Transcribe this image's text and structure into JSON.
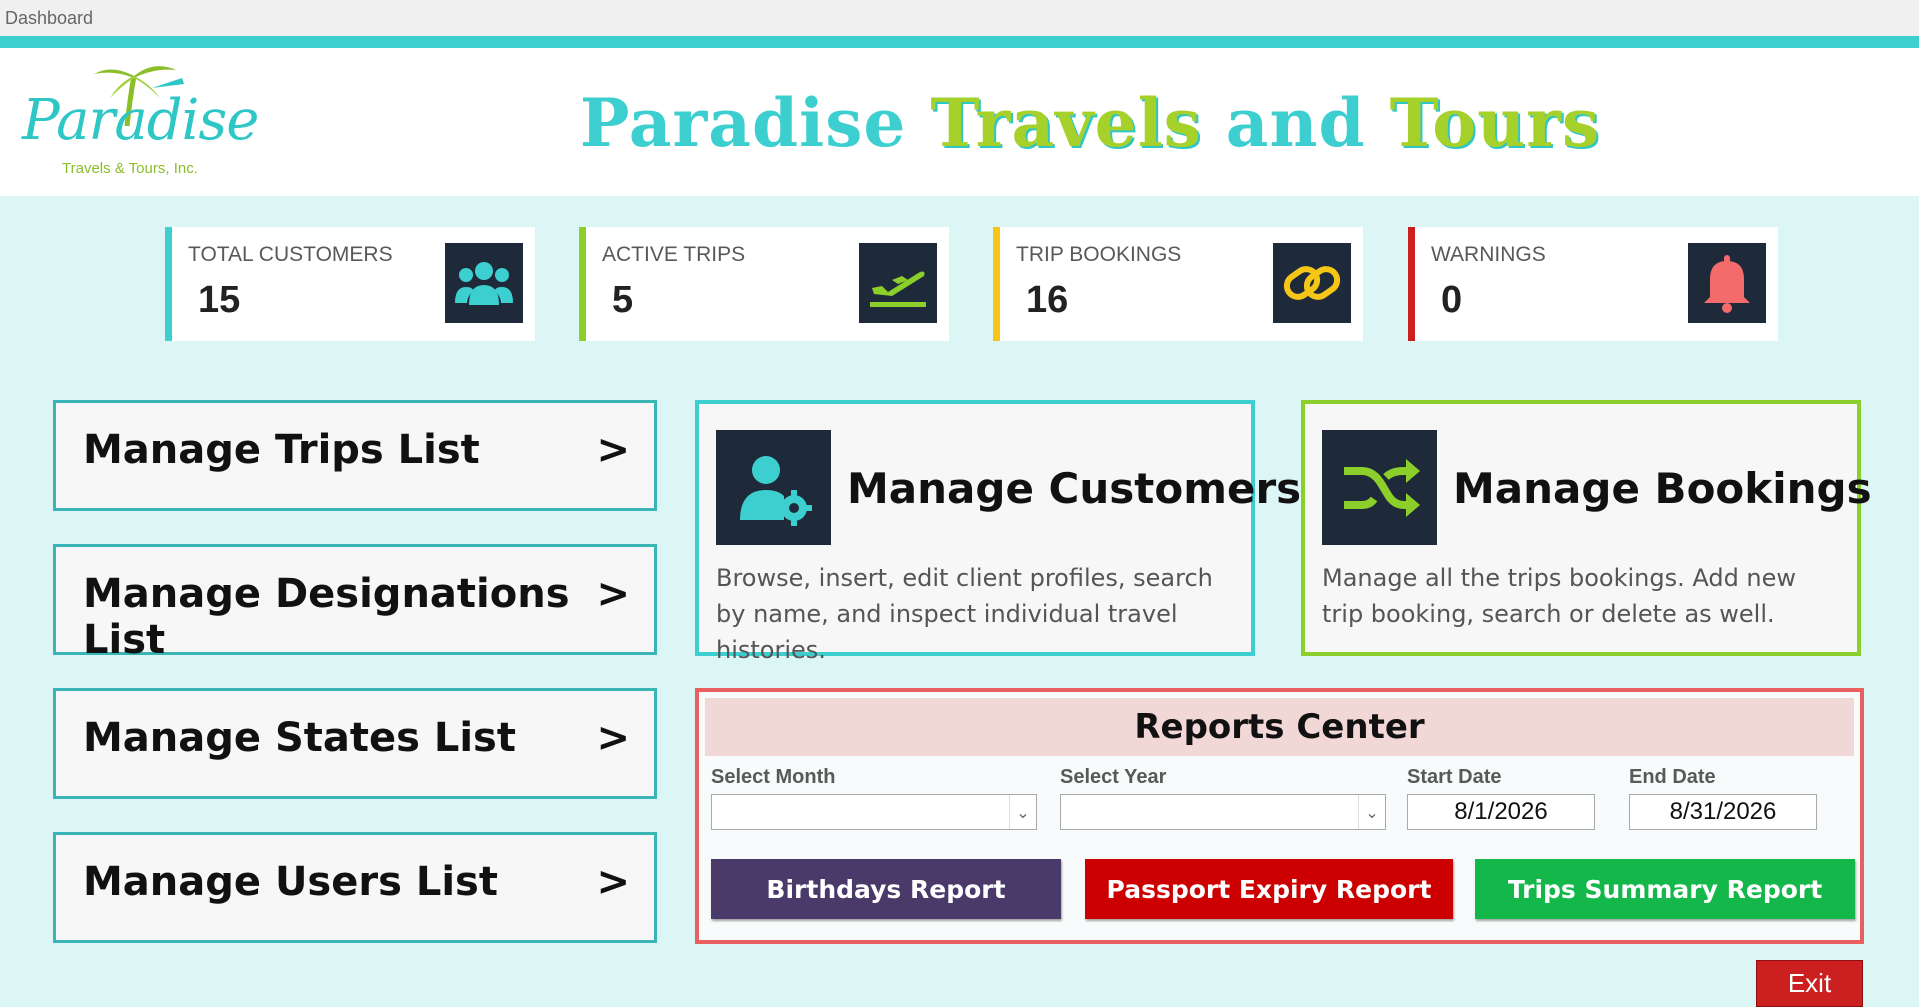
{
  "window": {
    "title": "Dashboard"
  },
  "header": {
    "logo_script": "Paradise",
    "logo_sub": "Travels & Tours, Inc.",
    "title_part1": "Paradise ",
    "title_part2": "Travels",
    "title_part3": " and ",
    "title_part4": "Tours"
  },
  "stats": [
    {
      "label": "TOTAL CUSTOMERS",
      "value": "15",
      "icon": "users-icon",
      "accent": "#3dcfcf",
      "icon_color": "#3dcfcf"
    },
    {
      "label": "ACTIVE TRIPS",
      "value": "5",
      "icon": "plane-departure-icon",
      "accent": "#8ccf2a",
      "icon_color": "#8ccf2a"
    },
    {
      "label": "TRIP BOOKINGS",
      "value": "16",
      "icon": "link-icon",
      "accent": "#f5c518",
      "icon_color": "#f5c518"
    },
    {
      "label": "WARNINGS",
      "value": "0",
      "icon": "bell-icon",
      "accent": "#cc1f1f",
      "icon_color": "#f36b6b"
    }
  ],
  "nav": [
    {
      "label": "Manage Trips List",
      "arrow": ">"
    },
    {
      "label": "Manage Designations List",
      "arrow": ">"
    },
    {
      "label": "Manage States List",
      "arrow": ">"
    },
    {
      "label": "Manage Users List",
      "arrow": ">"
    }
  ],
  "cards": {
    "customers": {
      "title": "Manage Customers",
      "desc": "Browse, insert, edit client profiles, search by name, and inspect individual travel histories.",
      "icon": "user-settings-icon",
      "border": "#3dcfcf"
    },
    "bookings": {
      "title": "Manage Bookings",
      "desc": "Manage all the trips bookings. Add new trip booking, search or delete as well.",
      "icon": "shuffle-icon",
      "border": "#8ccf2a"
    }
  },
  "reports": {
    "title": "Reports Center",
    "select_month_label": "Select Month",
    "select_month_value": "",
    "select_year_label": "Select Year",
    "select_year_value": "",
    "start_date_label": "Start Date",
    "start_date_value": "8/1/2026",
    "end_date_label": "End Date",
    "end_date_value": "8/31/2026",
    "buttons": [
      {
        "label": "Birthdays Report",
        "color": "#4a3a6a"
      },
      {
        "label": "Passport Expiry Report",
        "color": "#cc0000"
      },
      {
        "label": "Trips Summary Report",
        "color": "#14b84a"
      }
    ]
  },
  "exit_label": "Exit"
}
